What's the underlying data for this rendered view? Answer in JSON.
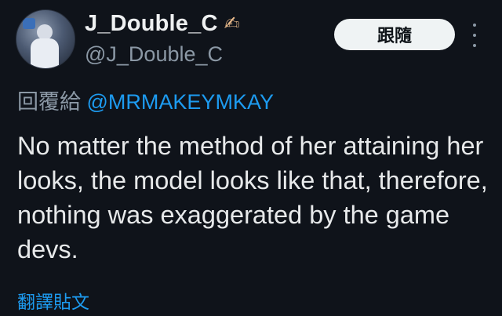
{
  "user": {
    "display_name": "J_Double_C",
    "emoji": "✍",
    "handle": "@J_Double_C"
  },
  "actions": {
    "follow_label": "跟隨"
  },
  "reply": {
    "prefix": "回覆給",
    "mention": "@MRMAKEYMKAY"
  },
  "tweet": {
    "text": "No matter the method of her attaining her looks, the model looks like that, therefore, nothing was exaggerated by the game devs."
  },
  "translate": {
    "label": "翻譯貼文"
  },
  "colors": {
    "background": "#0f131a",
    "accent": "#1d9bf0",
    "secondary_text": "#8b98a5",
    "primary_text": "#e7e9ea"
  }
}
